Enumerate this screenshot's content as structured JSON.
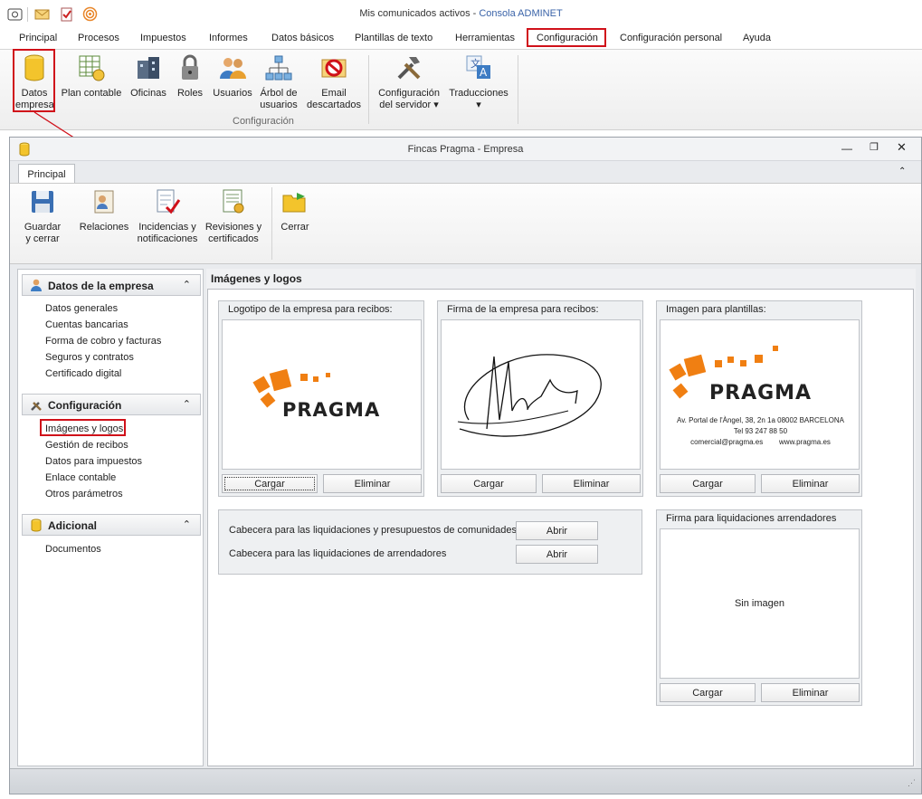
{
  "app": {
    "title_prefix": "Mis comunicados activos - ",
    "title_app": "Consola ADMINET"
  },
  "menu": [
    "Principal",
    "Procesos",
    "Impuestos",
    "Informes",
    "Datos básicos",
    "Plantillas de texto",
    "Herramientas",
    "Configuración",
    "Configuración personal",
    "Ayuda"
  ],
  "ribbon": {
    "buttons": [
      {
        "label1": "Datos",
        "label2": "empresa"
      },
      {
        "label1": "Plan contable",
        "label2": ""
      },
      {
        "label1": "Oficinas",
        "label2": ""
      },
      {
        "label1": "Roles",
        "label2": ""
      },
      {
        "label1": "Usuarios",
        "label2": ""
      },
      {
        "label1": "Árbol de",
        "label2": "usuarios"
      },
      {
        "label1": "Email",
        "label2": "descartados"
      },
      {
        "label1": "Configuración",
        "label2": "del servidor ▾"
      },
      {
        "label1": "Traducciones",
        "label2": "▾"
      }
    ],
    "group_label": "Configuración"
  },
  "window": {
    "title": "Fincas Pragma - Empresa",
    "tab": "Principal",
    "buttons": [
      {
        "label1": "Guardar",
        "label2": "y cerrar"
      },
      {
        "label1": "Relaciones",
        "label2": ""
      },
      {
        "label1": "Incidencias y",
        "label2": "notificaciones"
      },
      {
        "label1": "Revisiones y",
        "label2": "certificados"
      },
      {
        "label1": "Cerrar",
        "label2": ""
      }
    ]
  },
  "nav": {
    "sections": [
      {
        "title": "Datos de la empresa",
        "items": [
          "Datos generales",
          "Cuentas bancarias",
          "Forma de cobro y facturas",
          "Seguros y contratos",
          "Certificado digital"
        ]
      },
      {
        "title": "Configuración",
        "items": [
          "Imágenes y logos",
          "Gestión de recibos",
          "Datos para impuestos",
          "Enlace contable",
          "Otros parámetros"
        ]
      },
      {
        "title": "Adicional",
        "items": [
          "Documentos"
        ]
      }
    ]
  },
  "content": {
    "title": "Imágenes y logos",
    "groups": {
      "logo": "Logotipo de la empresa para recibos:",
      "firma": "Firma de la empresa para recibos:",
      "plantillas": "Imagen para plantillas:",
      "firma_arr": "Firma para liquidaciones arrendadores"
    },
    "logo_word": "PRAGMA",
    "address1": "Av. Portal de l'Àngel, 38, 2n 1a    08002 BARCELONA",
    "address2": "Tel 93 247 88 50",
    "address3": "comercial@pragma.es        www.pragma.es",
    "cargar": "Cargar",
    "eliminar": "Eliminar",
    "cabecera1": "Cabecera para las liquidaciones y presupuestos de comunidades",
    "cabecera2": "Cabecera para las liquidaciones de arrendadores",
    "abrir": "Abrir",
    "sin_imagen": "Sin imagen"
  },
  "colors": {
    "accent": "#3a63a8",
    "highlight": "#d0111a",
    "logo_orange": "#f07f12"
  }
}
